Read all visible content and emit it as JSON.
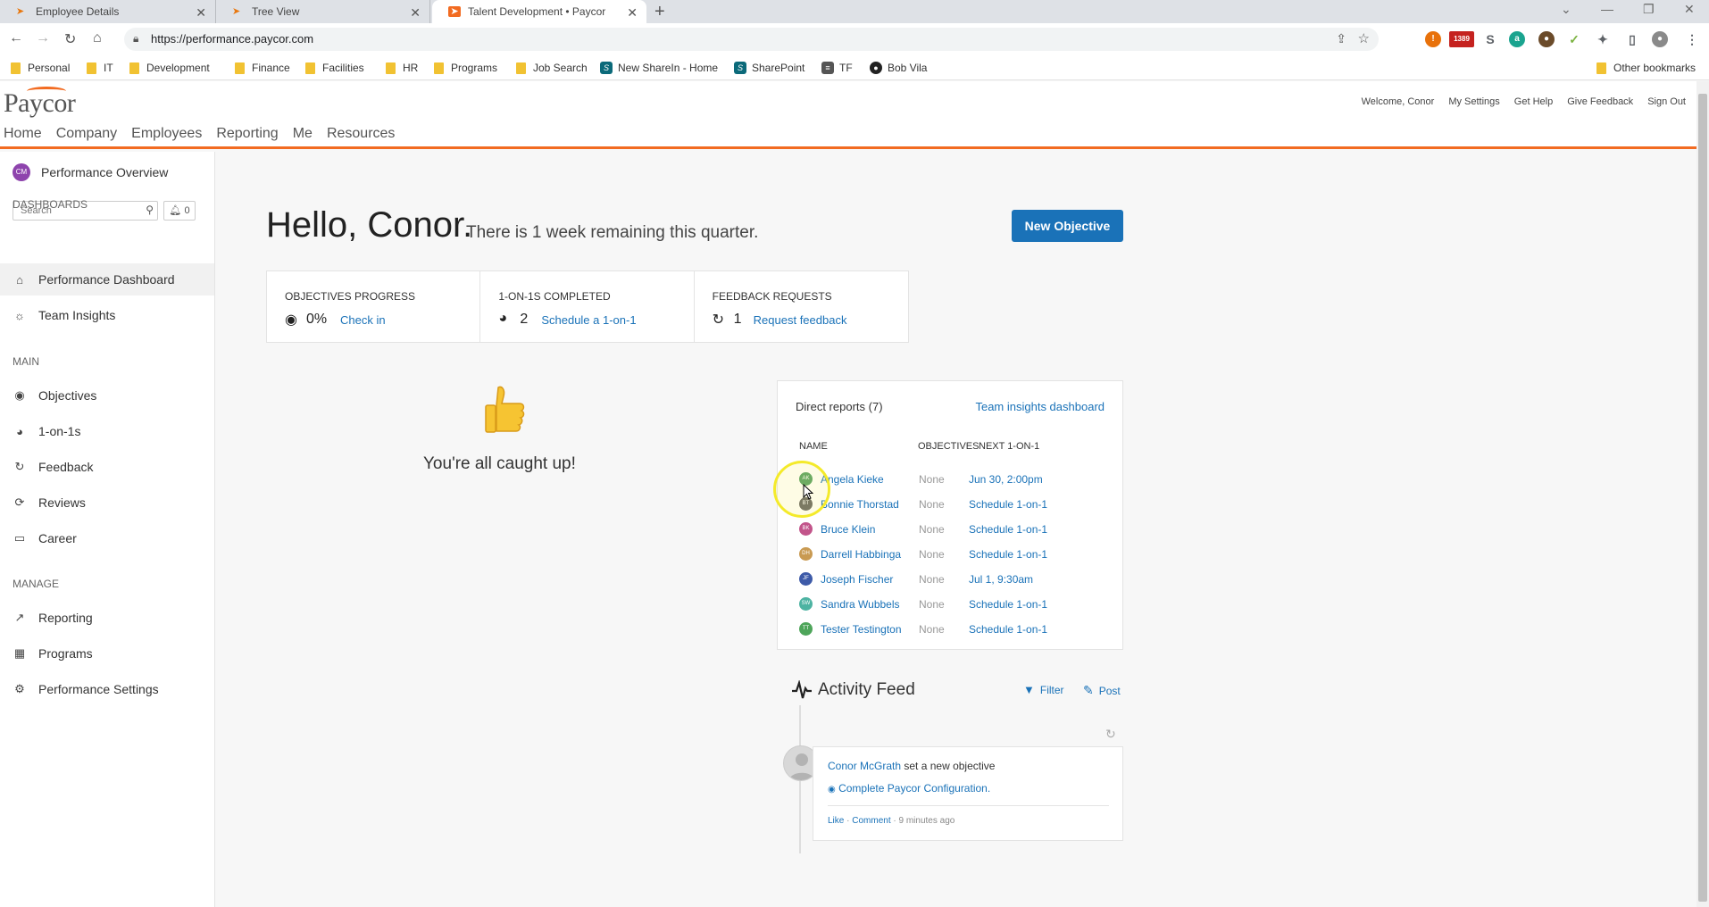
{
  "browser": {
    "tabs": [
      {
        "title": "Employee Details"
      },
      {
        "title": "Tree View"
      },
      {
        "title": "Talent Development • Paycor"
      }
    ],
    "url": "https://performance.paycor.com",
    "extension_badge": "1389",
    "bookmarks": [
      "Personal",
      "IT",
      "Development",
      "Finance",
      "Facilities",
      "HR",
      "Programs",
      "Job Search",
      "New ShareIn - Home",
      "SharePoint",
      "TF",
      "Bob Vila"
    ],
    "other_bookmarks": "Other bookmarks"
  },
  "header": {
    "logo": "Paycor",
    "nav": [
      "Home",
      "Company",
      "Employees",
      "Reporting",
      "Me",
      "Resources"
    ],
    "links": [
      "Welcome, Conor",
      "My Settings",
      "Get Help",
      "Give Feedback",
      "Sign Out"
    ]
  },
  "sidebar": {
    "avatar_initials": "CM",
    "title": "Performance Overview",
    "search_placeholder": "Search",
    "notifications": "0",
    "sections": {
      "dashboards": "DASHBOARDS",
      "main": "MAIN",
      "manage": "MANAGE"
    },
    "dashboards": [
      {
        "label": "Performance Dashboard",
        "icon": "home-icon"
      },
      {
        "label": "Team Insights",
        "icon": "lightbulb-icon"
      }
    ],
    "main": [
      {
        "label": "Objectives",
        "icon": "target-icon"
      },
      {
        "label": "1-on-1s",
        "icon": "chat-icon"
      },
      {
        "label": "Feedback",
        "icon": "feedback-icon"
      },
      {
        "label": "Reviews",
        "icon": "reviews-icon"
      },
      {
        "label": "Career",
        "icon": "briefcase-icon"
      }
    ],
    "manage": [
      {
        "label": "Reporting",
        "icon": "trend-icon"
      },
      {
        "label": "Programs",
        "icon": "calendar-icon"
      },
      {
        "label": "Performance Settings",
        "icon": "gear-icon"
      }
    ]
  },
  "main": {
    "greeting": "Hello, Conor.",
    "remaining": "There is 1 week remaining this quarter.",
    "new_objective": "New Objective",
    "stats": [
      {
        "label": "OBJECTIVES PROGRESS",
        "value": "0%",
        "link": "Check in"
      },
      {
        "label": "1-ON-1S COMPLETED",
        "value": "2",
        "link": "Schedule a 1-on-1"
      },
      {
        "label": "FEEDBACK REQUESTS",
        "value": "1",
        "link": "Request feedback"
      }
    ],
    "caught_up": "You're all caught up!",
    "direct_reports": {
      "title": "Direct reports (7)",
      "link": "Team insights dashboard",
      "columns": [
        "NAME",
        "OBJECTIVES",
        "NEXT 1-ON-1"
      ],
      "rows": [
        {
          "initials": "AK",
          "name": "Angela Kieke",
          "objectives": "None",
          "next": "Jun 30, 2:00pm",
          "color": "#5aa36a"
        },
        {
          "initials": "BT",
          "name": "Bonnie Thorstad",
          "objectives": "None",
          "next": "Schedule 1-on-1",
          "color": "#6b6b6b"
        },
        {
          "initials": "BK",
          "name": "Bruce Klein",
          "objectives": "None",
          "next": "Schedule 1-on-1",
          "color": "#c2548a"
        },
        {
          "initials": "DH",
          "name": "Darrell Habbinga",
          "objectives": "None",
          "next": "Schedule 1-on-1",
          "color": "#c99a52"
        },
        {
          "initials": "JF",
          "name": "Joseph Fischer",
          "objectives": "None",
          "next": "Jul 1, 9:30am",
          "color": "#3d5aa8"
        },
        {
          "initials": "SW",
          "name": "Sandra Wubbels",
          "objectives": "None",
          "next": "Schedule 1-on-1",
          "color": "#4db3a2"
        },
        {
          "initials": "TT",
          "name": "Tester Testington",
          "objectives": "None",
          "next": "Schedule 1-on-1",
          "color": "#4ea55a"
        }
      ]
    },
    "activity": {
      "title": "Activity Feed",
      "filter": "Filter",
      "post": "Post",
      "item": {
        "author": "Conor McGrath",
        "action": "set a new objective",
        "objective": "Complete Paycor Configuration.",
        "like": "Like",
        "comment": "Comment",
        "time": "9 minutes ago"
      }
    }
  },
  "colors": {
    "accent": "#1a72b8",
    "brand_orange": "#f26b21"
  }
}
